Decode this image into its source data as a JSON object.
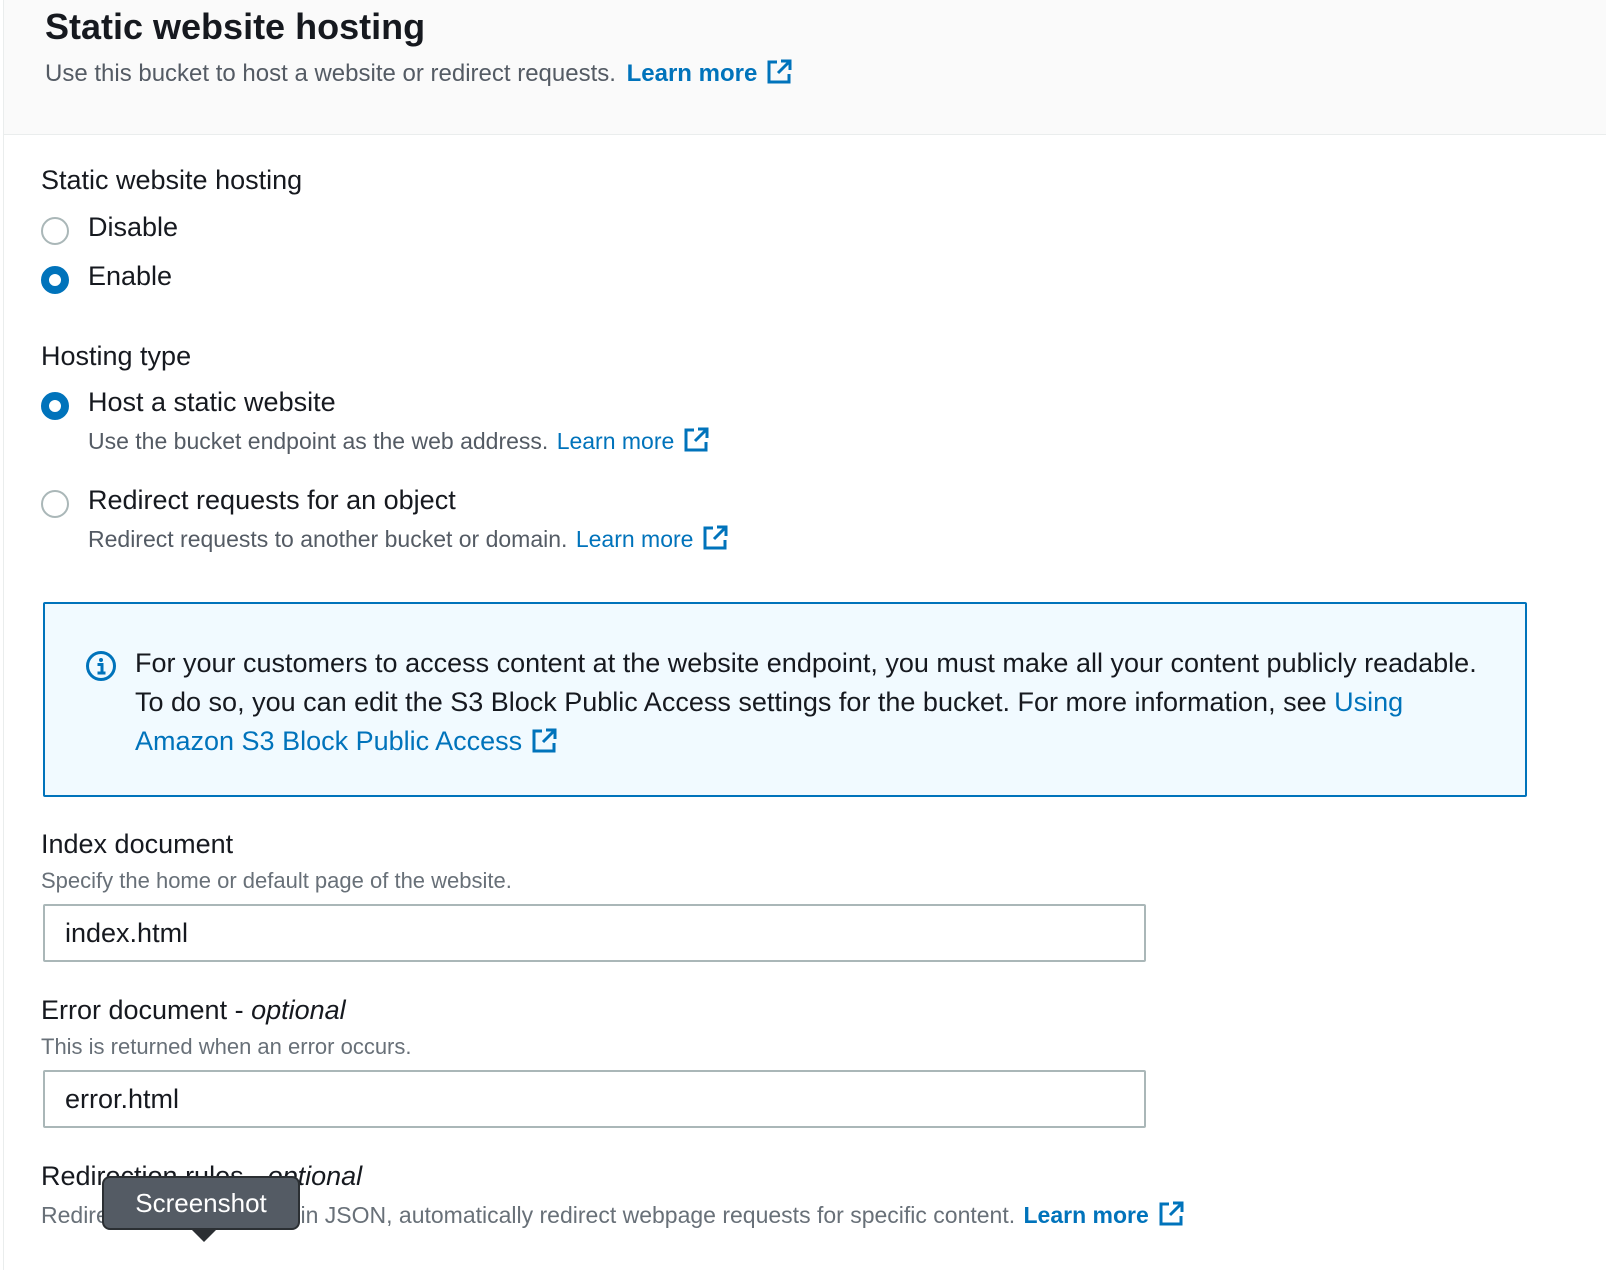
{
  "header": {
    "title": "Static website hosting",
    "description": "Use this bucket to host a website or redirect requests.",
    "learn_more": "Learn more"
  },
  "hosting": {
    "label": "Static website hosting",
    "options": [
      {
        "label": "Disable",
        "checked": false
      },
      {
        "label": "Enable",
        "checked": true
      }
    ]
  },
  "hosting_type": {
    "label": "Hosting type",
    "options": [
      {
        "label": "Host a static website",
        "description": "Use the bucket endpoint as the web address.",
        "learn_more": "Learn more",
        "checked": true
      },
      {
        "label": "Redirect requests for an object",
        "description": "Redirect requests to another bucket or domain.",
        "learn_more": "Learn more",
        "checked": false
      }
    ]
  },
  "alert": {
    "text": "For your customers to access content at the website endpoint, you must make all your content publicly readable. To do so, you can edit the S3 Block Public Access settings for the bucket. For more information, see",
    "link": "Using Amazon S3 Block Public Access",
    "icon": "info-icon"
  },
  "index_document": {
    "label": "Index document",
    "description": "Specify the home or default page of the website.",
    "value": "index.html"
  },
  "error_document": {
    "label": "Error document - ",
    "label_optional": "optional",
    "description": "This is returned when an error occurs.",
    "value": "error.html"
  },
  "redirection_rules": {
    "label": "Redirection rules - ",
    "label_optional": "optional",
    "description": "Redirection rules, written in JSON, automatically redirect webpage requests for specific content.",
    "learn_more": "Learn more"
  },
  "tooltip": {
    "text": "Screenshot"
  },
  "colors": {
    "accent": "#0073bb",
    "alert_bg": "#f1faff",
    "header_bg": "#fafafa"
  }
}
